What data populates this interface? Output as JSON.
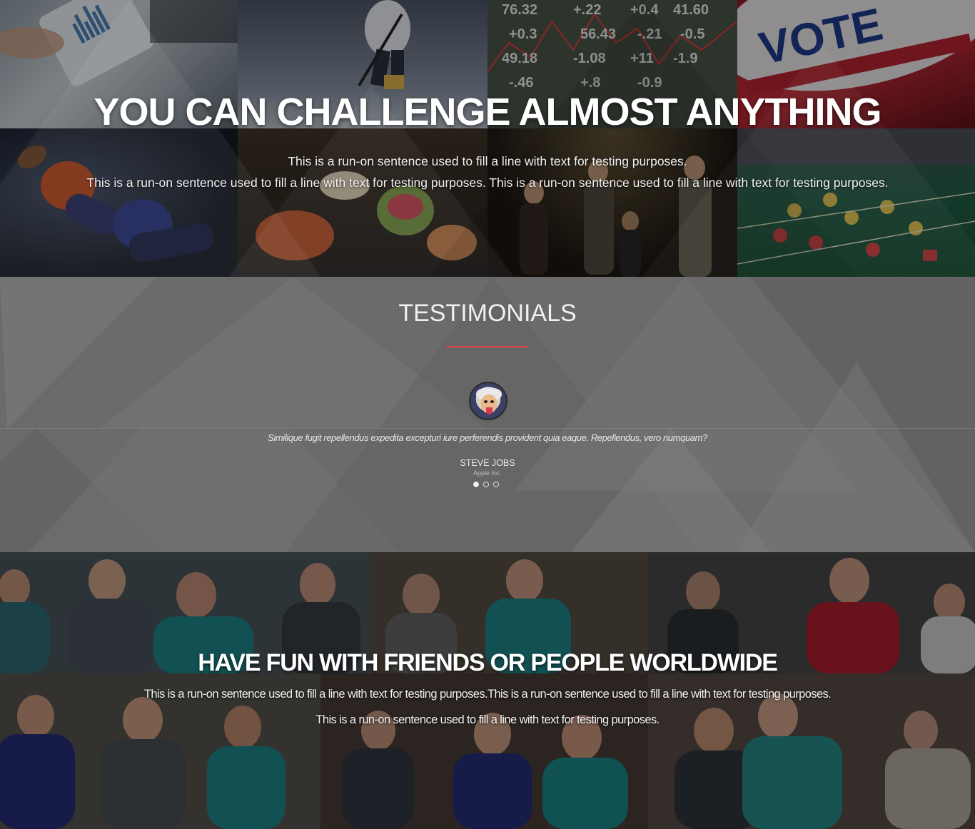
{
  "hero": {
    "title": "YOU CAN CHALLENGE ALMOST ANYTHING",
    "line1": "This is a run-on sentence used to fill a line with text for testing purposes.",
    "line2": "This is a run-on sentence used to fill a line with text for testing purposes. This is a run-on sentence used to fill a line with text for testing purposes.",
    "tiles": [
      {
        "subject": "business-chart-tablet",
        "color": "#6e7a85"
      },
      {
        "subject": "hockey-player",
        "color": "#3e4452"
      },
      {
        "subject": "stock-numbers",
        "color": "#3a2f33"
      },
      {
        "subject": "vote-button",
        "color": "#7a1d28"
      },
      {
        "subject": "american-football",
        "color": "#1e2436"
      },
      {
        "subject": "food-sushi",
        "color": "#3b3226"
      },
      {
        "subject": "concert-band",
        "color": "#2a2622"
      },
      {
        "subject": "casino-roulette",
        "color": "#1f3b30"
      }
    ],
    "ticker": [
      "76.32",
      "+.22",
      "+0.4",
      "41.60",
      "+0.3",
      "56.43",
      "-.21",
      "-0.5",
      "49.18",
      "-1.08",
      "+11",
      "-1.9",
      "-.46",
      "+.8",
      "-0.9"
    ],
    "vote_text": "VOTE"
  },
  "testimonials": {
    "title": "TESTIMONIALS",
    "quote": "Similique fugit repellendus expedita excepturi iure perferendis provident quia eaque. Repellendus, vero numquam?",
    "author": "STEVE JOBS",
    "company": "Apple Inc.",
    "accent": "#e0434e",
    "slides": 3,
    "active_slide": 1
  },
  "friends": {
    "title": "HAVE FUN WITH FRIENDS OR PEOPLE WORLDWIDE",
    "line1": "This is a run-on sentence used to fill a line with text for testing purposes.This is a run-on sentence used to fill a line with text for testing purposes.",
    "line2": "This is a run-on sentence used to fill a line with text for testing purposes."
  }
}
